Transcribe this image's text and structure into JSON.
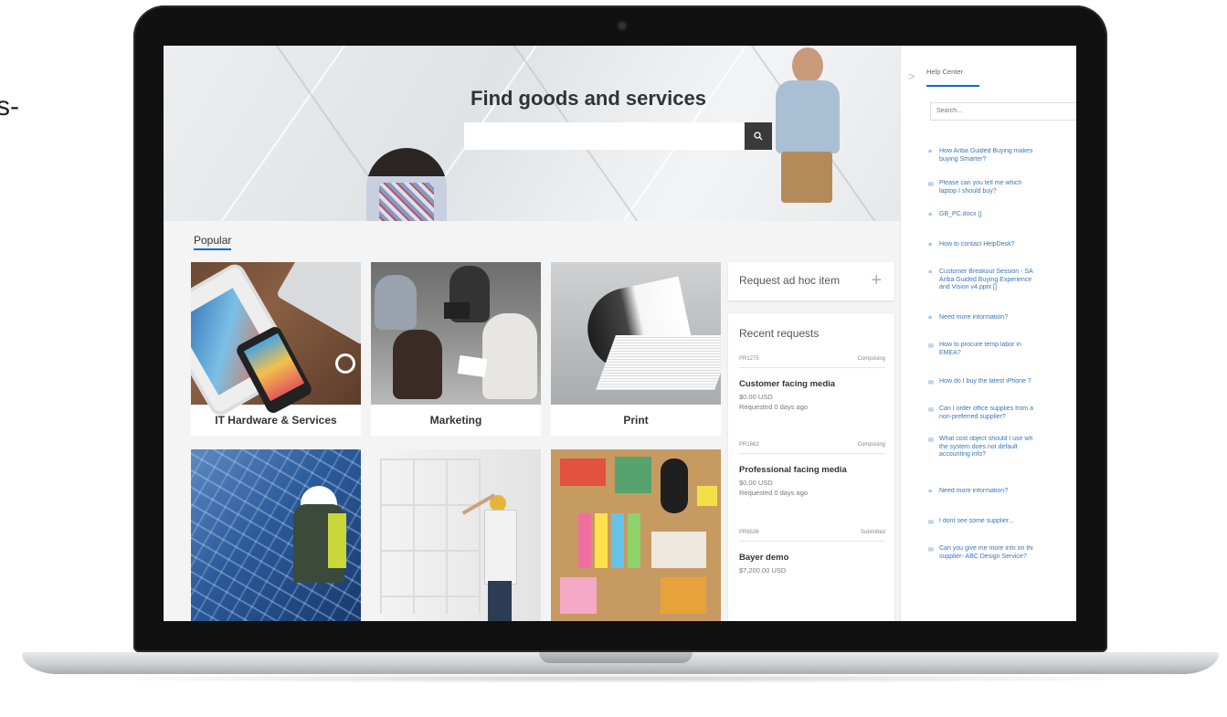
{
  "edge_text": "s-",
  "hero": {
    "title": "Find goods and services",
    "search_placeholder": ""
  },
  "popular": {
    "tab_label": "Popular",
    "tiles": [
      {
        "label": "IT Hardware & Services",
        "image": "tablet-phone-laptop-photo"
      },
      {
        "label": "Marketing",
        "image": "business-meeting-photo"
      },
      {
        "label": "Print",
        "image": "magazine-photo"
      },
      {
        "label": "",
        "image": "solar-panel-worker-photo"
      },
      {
        "label": "",
        "image": "architects-window-photo"
      },
      {
        "label": "",
        "image": "office-supplies-photo"
      }
    ]
  },
  "adhoc": {
    "label": "Request ad hoc item",
    "icon": "plus-icon"
  },
  "recent": {
    "heading": "Recent requests",
    "items": [
      {
        "id": "PR1275",
        "status": "Composing",
        "title": "Customer facing media",
        "amount": "$0.00 USD",
        "requested": "Requested 0 days ago"
      },
      {
        "id": "PR1662",
        "status": "Composing",
        "title": "Professional facing media",
        "amount": "$0.00 USD",
        "requested": "Requested 0 days ago"
      },
      {
        "id": "PR6536",
        "status": "Submitted",
        "title": "Bayer demo",
        "amount": "$7,200.00 USD",
        "requested": ""
      }
    ]
  },
  "help": {
    "title": "Help Center",
    "search_placeholder": "Search...",
    "items": [
      {
        "icon": "document-icon",
        "text": [
          "How Ariba Guided Buying makes",
          "buying Smarter?"
        ]
      },
      {
        "icon": "chat-icon",
        "text": [
          "Please can you tell me which",
          "laptop I should buy?"
        ]
      },
      {
        "icon": "document-icon",
        "text": [
          "GB_PC.docx []"
        ]
      },
      {
        "icon": "document-icon",
        "text": [
          "How to contact HelpDesk?"
        ]
      },
      {
        "icon": "document-icon",
        "text": [
          "Customer Breakout Session - SA",
          "Ariba Guided Buying Experience",
          "and Vision v4.pptx []"
        ]
      },
      {
        "icon": "document-icon",
        "text": [
          "Need more information?"
        ]
      },
      {
        "icon": "chat-icon",
        "text": [
          "How to procure temp labor in",
          "EMEA?"
        ]
      },
      {
        "icon": "chat-icon",
        "text": [
          "How do I buy the latest iPhone 7"
        ]
      },
      {
        "icon": "chat-icon",
        "text": [
          "Can I order office supplies from a",
          "non-preferred supplier?"
        ]
      },
      {
        "icon": "chat-icon",
        "text": [
          "What cost object should I use wh",
          "the system does not default",
          "accounting info?"
        ]
      },
      {
        "icon": "document-icon",
        "text": [
          "Need more information?"
        ]
      },
      {
        "icon": "chat-icon",
        "text": [
          "I dont see some supplier..."
        ]
      },
      {
        "icon": "chat-icon",
        "text": [
          "Can you give me more info on thi",
          "supplier- ABC Design Service?"
        ]
      }
    ]
  },
  "colors": {
    "accent": "#0a6ed1",
    "link": "#3a75b8",
    "bezel": "#111111"
  }
}
